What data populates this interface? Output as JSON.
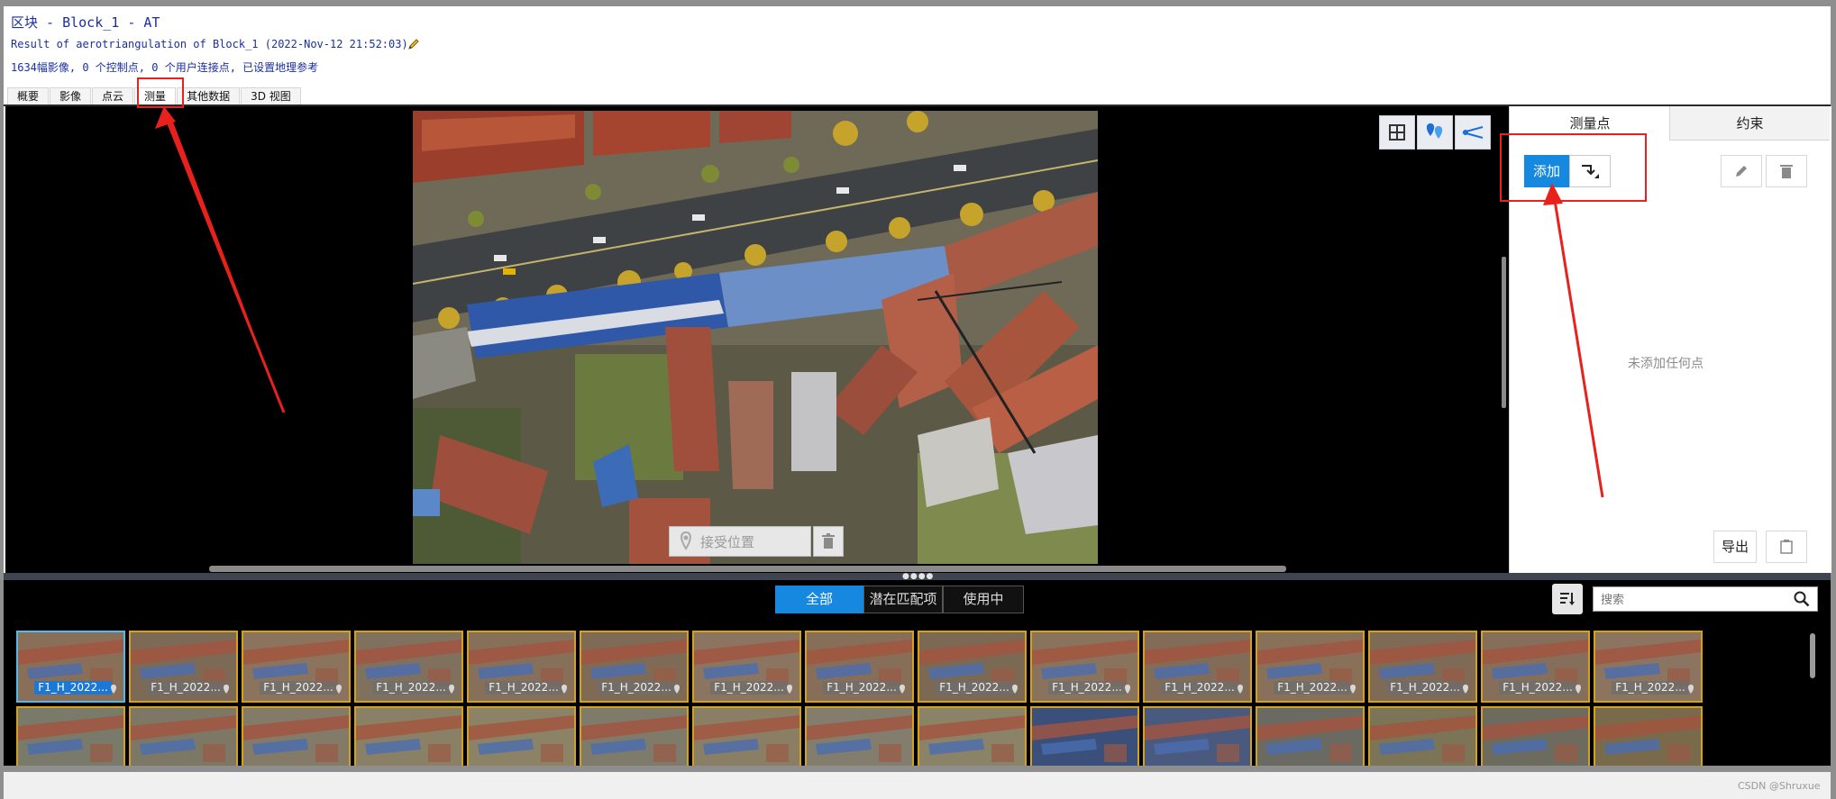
{
  "header": {
    "title": "区块 - Block_1 - AT",
    "result_line": "Result of aerotriangulation of Block_1 (2022-Nov-12 21:52:03)",
    "stats_line": "1634幅影像, 0 个控制点, 0 个用户连接点, 已设置地理参考"
  },
  "tabs": [
    "概要",
    "影像",
    "点云",
    "测量",
    "其他数据",
    "3D 视图"
  ],
  "active_tab": "测量",
  "viewer": {
    "toolbar_icons": [
      "grid-add-icon",
      "location-pins-icon",
      "scissors-icon"
    ],
    "accept_position_label": "接受位置"
  },
  "right_panel": {
    "tabs": [
      "测量点",
      "约束"
    ],
    "add_label": "添加",
    "empty_message": "未添加任何点",
    "export_label": "导出"
  },
  "filter": {
    "buttons": [
      "全部",
      "潜在匹配项",
      "使用中"
    ],
    "active": "全部"
  },
  "search": {
    "placeholder": "搜索"
  },
  "thumbnails": {
    "row1_label": "F1_H_2022...",
    "row1_count": 15,
    "row2_count": 15
  },
  "watermark": "CSDN @Shruxue",
  "colors": {
    "accent": "#1688e0",
    "thumb_border": "#d3a21d",
    "annotation": "#e8211d",
    "header_text": "#1a2fa0"
  }
}
